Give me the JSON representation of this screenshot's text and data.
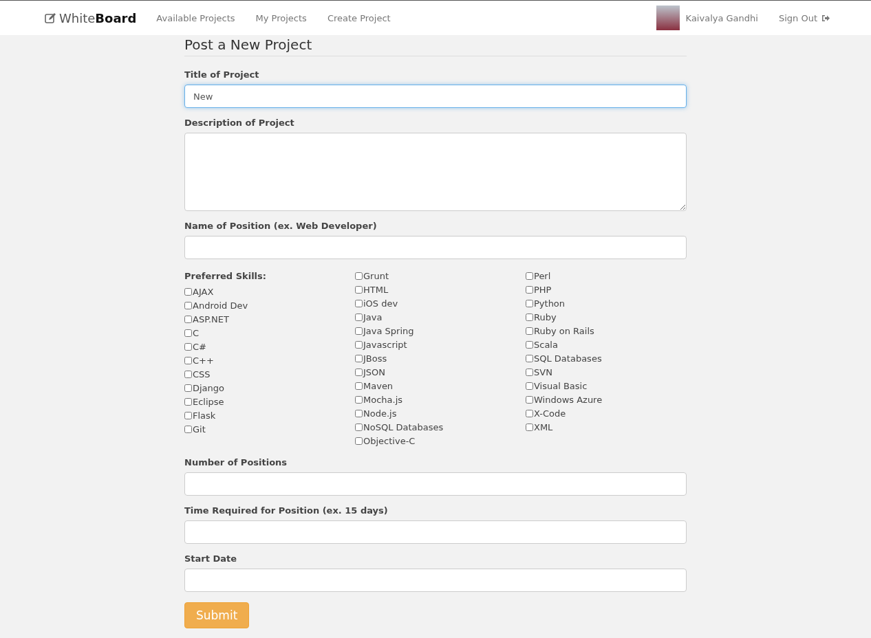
{
  "navbar": {
    "brand": "White**Board**",
    "links": [
      {
        "label": "Available Projects",
        "selected": false
      },
      {
        "label": "My Projects",
        "selected": false
      },
      {
        "label": "Create Project",
        "selected": false
      }
    ],
    "user": {
      "name": "Kaivalya Gandhi"
    },
    "sign_out": "Sign Out"
  },
  "form": {
    "title": "Post a New Project",
    "fields": [
      {
        "kind": "input",
        "label": "Title of Project",
        "value": "New",
        "focused": true
      },
      {
        "kind": "textarea",
        "label": "Description of Project",
        "focused": false
      },
      {
        "kind": "input",
        "label": "Name of Position (ex. Web Developer)",
        "focused": false
      },
      {
        "kind": "skills",
        "label": "Preferred Skills:",
        "columns": [
          [
            {
              "label": "AJAX",
              "checked": false
            },
            {
              "label": "Android Dev",
              "checked": false
            },
            {
              "label": "ASP.NET",
              "checked": false
            },
            {
              "label": "C",
              "checked": false
            },
            {
              "label": "C#",
              "checked": false
            },
            {
              "label": "C++",
              "checked": false
            },
            {
              "label": "CSS",
              "checked": false
            },
            {
              "label": "Django",
              "checked": false
            },
            {
              "label": "Eclipse",
              "checked": false
            },
            {
              "label": "Flask",
              "checked": false
            },
            {
              "label": "Git",
              "checked": false
            }
          ],
          [
            {
              "label": "Grunt",
              "checked": false
            },
            {
              "label": "HTML",
              "checked": false
            },
            {
              "label": "iOS dev",
              "checked": false
            },
            {
              "label": "Java",
              "checked": false
            },
            {
              "label": "Java Spring",
              "checked": false
            },
            {
              "label": "Javascript",
              "checked": false
            },
            {
              "label": "JBoss",
              "checked": false
            },
            {
              "label": "JSON",
              "checked": false
            },
            {
              "label": "Maven",
              "checked": false
            },
            {
              "label": "Mocha.js",
              "checked": false
            },
            {
              "label": "Node.js",
              "checked": false
            },
            {
              "label": "NoSQL Databases",
              "checked": false
            },
            {
              "label": "Objective-C",
              "checked": false
            }
          ],
          [
            {
              "label": "Perl",
              "checked": false
            },
            {
              "label": "PHP",
              "checked": false
            },
            {
              "label": "Python",
              "checked": false
            },
            {
              "label": "Ruby",
              "checked": false
            },
            {
              "label": "Ruby on Rails",
              "checked": false
            },
            {
              "label": "Scala",
              "checked": false
            },
            {
              "label": "SQL Databases",
              "checked": false
            },
            {
              "label": "SVN",
              "checked": false
            },
            {
              "label": "Visual Basic",
              "checked": false
            },
            {
              "label": "Windows Azure",
              "checked": false
            },
            {
              "label": "X-Code",
              "checked": false
            },
            {
              "label": "XML",
              "checked": false
            }
          ]
        ]
      },
      {
        "kind": "input",
        "label": "Number of Positions",
        "focused": false
      },
      {
        "kind": "input",
        "label": "Time Required for Position (ex. 15 days)",
        "focused": false
      },
      {
        "kind": "input",
        "label": "Start Date",
        "focused": false
      }
    ],
    "submit": "Submit"
  }
}
